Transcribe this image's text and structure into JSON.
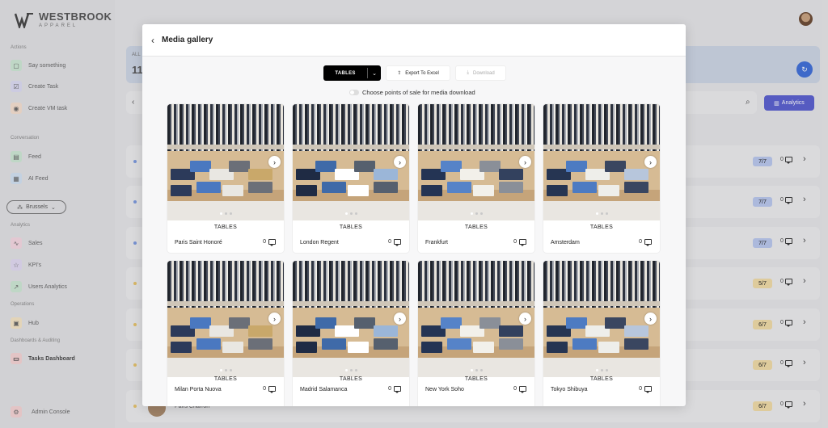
{
  "brand": {
    "name": "WESTBROOK",
    "sub": "APPAREL"
  },
  "sidebar": {
    "sections": [
      {
        "label": "Actions",
        "items": [
          {
            "label": "Say something",
            "icon": "chat-icon",
            "color": "#9ad3a5"
          },
          {
            "label": "Create Task",
            "icon": "checkbox-icon",
            "color": "#b8b6e8"
          },
          {
            "label": "Create VM task",
            "icon": "camera-icon",
            "color": "#f0c6a6"
          }
        ]
      },
      {
        "label": "Conversation",
        "items": [
          {
            "label": "Feed",
            "icon": "feed-icon",
            "color": "#9ad3a5"
          },
          {
            "label": "AI Feed",
            "icon": "ai-feed-icon",
            "color": "#9fc3e6"
          }
        ]
      },
      {
        "label": "Analytics",
        "items": [
          {
            "label": "Sales",
            "icon": "sales-icon",
            "color": "#efb1c6"
          },
          {
            "label": "KPI's",
            "icon": "star-icon",
            "color": "#c4b6e8"
          },
          {
            "label": "Users Analytics",
            "icon": "chart-icon",
            "color": "#9ad3a5"
          }
        ]
      },
      {
        "label": "Operations",
        "items": [
          {
            "label": "Hub",
            "icon": "hub-icon",
            "color": "#f0d49a"
          }
        ]
      },
      {
        "label": "Dashboards & Auditing",
        "items": [
          {
            "label": "Tasks Dashboard",
            "icon": "dashboard-icon",
            "color": "#efb1b1"
          }
        ]
      }
    ],
    "location": "Brussels",
    "admin": "Admin Console"
  },
  "background": {
    "header_label": "ALL",
    "header_number": "11",
    "analytics_label": "Analytics",
    "rows": [
      {
        "badge": "7/7",
        "badge_color": "#b9c8ee",
        "dot": "#7d9be0",
        "count": "0"
      },
      {
        "badge": "7/7",
        "badge_color": "#b9c8ee",
        "dot": "#7d9be0",
        "count": "0"
      },
      {
        "badge": "7/7",
        "badge_color": "#b9c8ee",
        "dot": "#7d9be0",
        "count": "0"
      },
      {
        "badge": "5/7",
        "badge_color": "#f1dca6",
        "dot": "#e8c46a",
        "count": "0"
      },
      {
        "badge": "6/7",
        "badge_color": "#f1dca6",
        "dot": "#e8c46a",
        "count": "0"
      },
      {
        "badge": "6/7",
        "badge_color": "#f1dca6",
        "dot": "#e8c46a",
        "count": "0"
      },
      {
        "badge": "6/7",
        "badge_color": "#f1dca6",
        "dot": "#e8c46a",
        "count": "0"
      }
    ],
    "last_row_name": "Paris Charron"
  },
  "modal": {
    "title": "Media gallery",
    "select_value": "TABLES",
    "export_label": "Export To Excel",
    "download_label": "Download",
    "toggle_label": "Choose points of sale for media download",
    "cards": [
      {
        "type": "TABLES",
        "name": "Paris Saint Honoré",
        "count": "0"
      },
      {
        "type": "TABLES",
        "name": "London Regent",
        "count": "0"
      },
      {
        "type": "TABLES",
        "name": "Frankfurt",
        "count": "0"
      },
      {
        "type": "TABLES",
        "name": "Amsterdam",
        "count": "0"
      },
      {
        "type": "TABLES",
        "name": "Milan Porta Nuova",
        "count": "0"
      },
      {
        "type": "TABLES",
        "name": "Madrid Salamanca",
        "count": "0"
      },
      {
        "type": "TABLES",
        "name": "New York Soho",
        "count": "0"
      },
      {
        "type": "TABLES",
        "name": "Tokyo Shibuya",
        "count": "0"
      }
    ]
  }
}
